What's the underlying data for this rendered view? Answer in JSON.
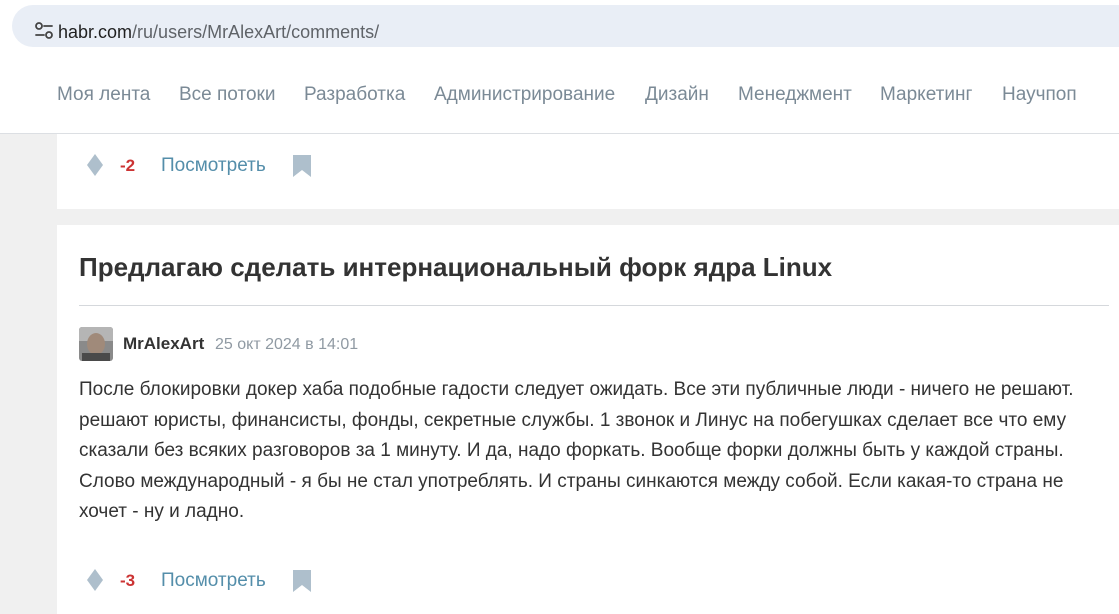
{
  "browser": {
    "url_host": "habr.com",
    "url_path": "/ru/users/MrAlexArt/comments/",
    "site_info_icon": "tune-icon"
  },
  "nav": {
    "items": [
      {
        "label": "Моя лента"
      },
      {
        "label": "Все потоки"
      },
      {
        "label": "Разработка"
      },
      {
        "label": "Администрирование"
      },
      {
        "label": "Дизайн"
      },
      {
        "label": "Менеджмент"
      },
      {
        "label": "Маркетинг"
      },
      {
        "label": "Научпоп"
      }
    ]
  },
  "previous_comment": {
    "score": "-2",
    "view_label": "Посмотреть"
  },
  "comment": {
    "post_title": "Предлагаю сделать интернациональный форк ядра Linux",
    "author": "MrAlexArt",
    "timestamp": "25 окт 2024 в 14:01",
    "text": "После блокировки докер хаба подобные гадости следует ожидать. Все эти публичные люди - ничего не решают. решают юристы, финансисты, фонды, секретные службы. 1 звонок и Линус на побегушках сделает все что ему сказали без всяких разговоров за 1 минуту. И да, надо форкать. Вообще форки должны быть у каждой страны. Слово международный - я бы не стал употреблять. И страны синкаются между собой. Если какая-то страна не хочет - ну и ладно.",
    "score": "-3",
    "view_label": "Посмотреть"
  },
  "colors": {
    "negative_score": "#cc3333",
    "link": "#548eaa",
    "nav_text": "#7b8a96",
    "icon": "#aebfcc"
  }
}
